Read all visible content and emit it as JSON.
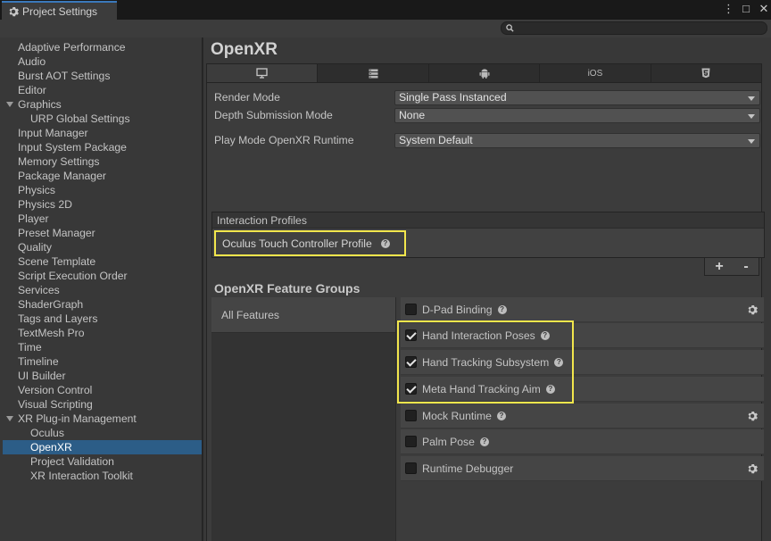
{
  "window": {
    "tab_title": "Project Settings",
    "controls": [
      "⋮",
      "□",
      "✕"
    ]
  },
  "search": {
    "placeholder": ""
  },
  "sidebar": {
    "items": [
      {
        "label": "Adaptive Performance",
        "level": 0
      },
      {
        "label": "Audio",
        "level": 0
      },
      {
        "label": "Burst AOT Settings",
        "level": 0
      },
      {
        "label": "Editor",
        "level": 0
      },
      {
        "label": "Graphics",
        "level": 0,
        "expanded": true
      },
      {
        "label": "URP Global Settings",
        "level": 1
      },
      {
        "label": "Input Manager",
        "level": 0
      },
      {
        "label": "Input System Package",
        "level": 0
      },
      {
        "label": "Memory Settings",
        "level": 0
      },
      {
        "label": "Package Manager",
        "level": 0
      },
      {
        "label": "Physics",
        "level": 0
      },
      {
        "label": "Physics 2D",
        "level": 0
      },
      {
        "label": "Player",
        "level": 0
      },
      {
        "label": "Preset Manager",
        "level": 0
      },
      {
        "label": "Quality",
        "level": 0
      },
      {
        "label": "Scene Template",
        "level": 0
      },
      {
        "label": "Script Execution Order",
        "level": 0
      },
      {
        "label": "Services",
        "level": 0
      },
      {
        "label": "ShaderGraph",
        "level": 0
      },
      {
        "label": "Tags and Layers",
        "level": 0
      },
      {
        "label": "TextMesh Pro",
        "level": 0
      },
      {
        "label": "Time",
        "level": 0
      },
      {
        "label": "Timeline",
        "level": 0
      },
      {
        "label": "UI Builder",
        "level": 0
      },
      {
        "label": "Version Control",
        "level": 0
      },
      {
        "label": "Visual Scripting",
        "level": 0
      },
      {
        "label": "XR Plug-in Management",
        "level": 0,
        "expanded": true
      },
      {
        "label": "Oculus",
        "level": 1
      },
      {
        "label": "OpenXR",
        "level": 1,
        "selected": true
      },
      {
        "label": "Project Validation",
        "level": 1
      },
      {
        "label": "XR Interaction Toolkit",
        "level": 1
      }
    ]
  },
  "main": {
    "title": "OpenXR",
    "platform_tabs": [
      {
        "icon": "desktop-icon",
        "label": "",
        "active": true
      },
      {
        "icon": "server-icon",
        "label": ""
      },
      {
        "icon": "android-icon",
        "label": ""
      },
      {
        "icon": "ios-icon",
        "label": "iOS"
      },
      {
        "icon": "html5-icon",
        "label": ""
      }
    ],
    "render_mode": {
      "label": "Render Mode",
      "value": "Single Pass Instanced"
    },
    "depth_mode": {
      "label": "Depth Submission Mode",
      "value": "None"
    },
    "runtime": {
      "label": "Play Mode OpenXR Runtime",
      "value": "System Default"
    },
    "interaction_profiles": {
      "header": "Interaction Profiles",
      "items": [
        "Oculus Touch Controller Profile"
      ],
      "add": "+",
      "remove": "-"
    },
    "feature_groups": {
      "title": "OpenXR Feature Groups",
      "groups": [
        "All Features"
      ],
      "features": [
        {
          "name": "D-Pad Binding",
          "checked": false,
          "has_settings": true
        },
        {
          "name": "Hand Interaction Poses",
          "checked": true,
          "has_settings": false
        },
        {
          "name": "Hand Tracking Subsystem",
          "checked": true,
          "has_settings": false
        },
        {
          "name": "Meta Hand Tracking Aim",
          "checked": true,
          "has_settings": false
        },
        {
          "name": "Mock Runtime",
          "checked": false,
          "has_settings": true
        },
        {
          "name": "Palm Pose",
          "checked": false,
          "has_settings": false
        },
        {
          "name": "Runtime Debugger",
          "checked": false,
          "has_settings": true
        }
      ]
    }
  },
  "colors": {
    "highlight": "#f2e64c",
    "selection": "#2c5d87",
    "tab_accent": "#3a79bb"
  }
}
